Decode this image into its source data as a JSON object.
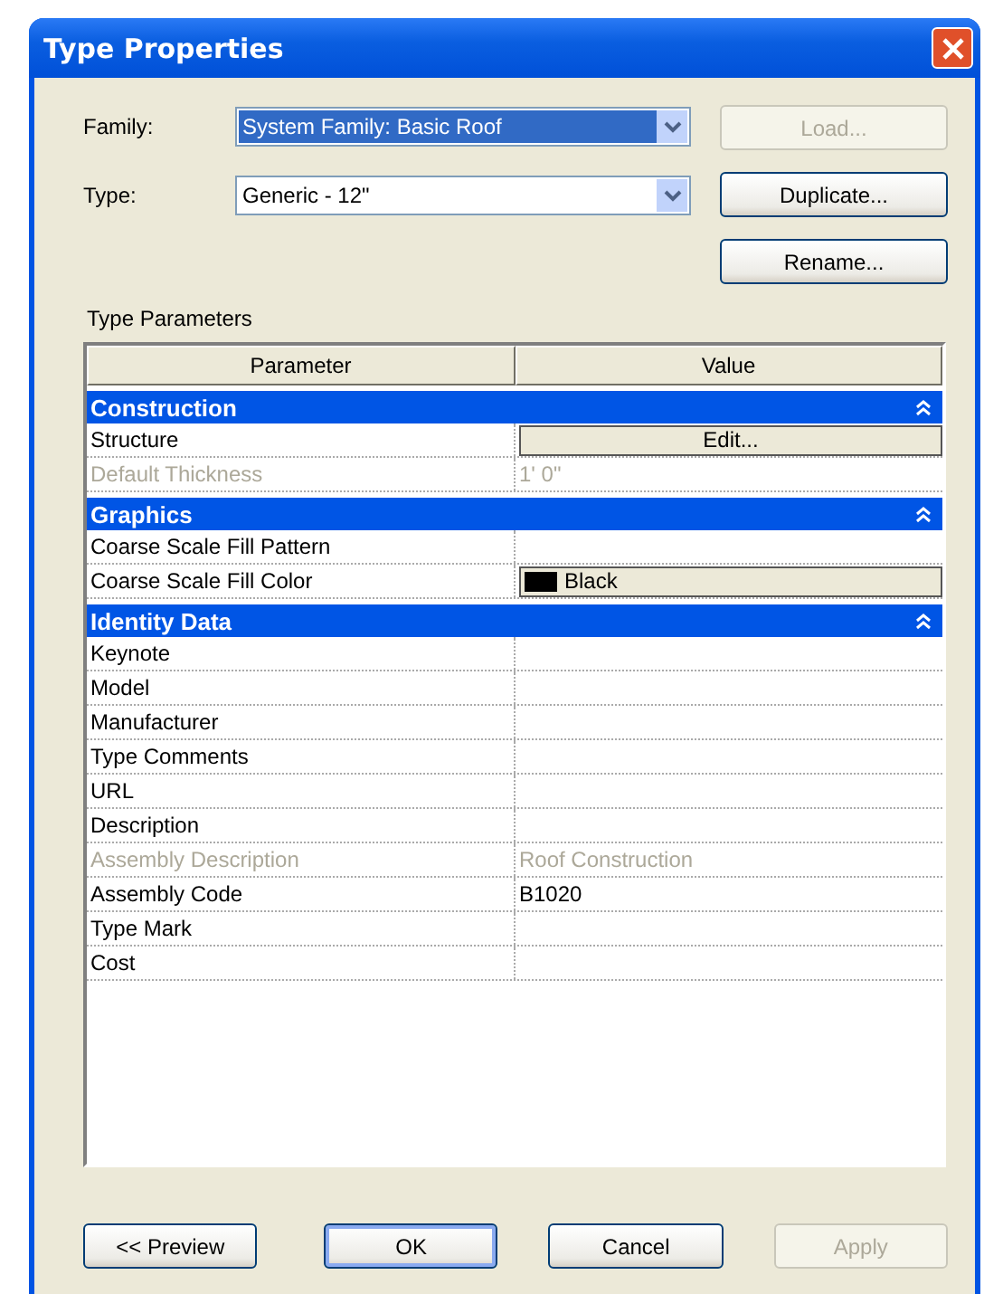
{
  "window": {
    "title": "Type Properties"
  },
  "family": {
    "label": "Family:",
    "value": "System Family: Basic Roof",
    "highlighted": true
  },
  "type": {
    "label": "Type:",
    "value": "Generic - 12\"",
    "highlighted": false
  },
  "side_buttons": [
    {
      "label": "Load...",
      "disabled": true,
      "default": false
    },
    {
      "label": "Duplicate...",
      "disabled": false,
      "default": false
    },
    {
      "label": "Rename...",
      "disabled": false,
      "default": false
    }
  ],
  "section_label": "Type Parameters",
  "table": {
    "columns": [
      "Parameter",
      "Value"
    ],
    "groups": [
      {
        "name": "Construction",
        "expanded": true,
        "rows": [
          {
            "name": "Structure",
            "kind": "button",
            "value": "Edit...",
            "disabled": false
          },
          {
            "name": "Default Thickness",
            "kind": "text",
            "value": "1'  0\"",
            "disabled": true
          }
        ]
      },
      {
        "name": "Graphics",
        "expanded": true,
        "rows": [
          {
            "name": "Coarse Scale Fill Pattern",
            "kind": "text",
            "value": "",
            "disabled": false
          },
          {
            "name": "Coarse Scale Fill Color",
            "kind": "color",
            "value": "Black",
            "color": "#000000",
            "disabled": false
          }
        ]
      },
      {
        "name": "Identity Data",
        "expanded": true,
        "rows": [
          {
            "name": "Keynote",
            "kind": "text",
            "value": "",
            "disabled": false
          },
          {
            "name": "Model",
            "kind": "text",
            "value": "",
            "disabled": false
          },
          {
            "name": "Manufacturer",
            "kind": "text",
            "value": "",
            "disabled": false
          },
          {
            "name": "Type Comments",
            "kind": "text",
            "value": "",
            "disabled": false
          },
          {
            "name": "URL",
            "kind": "text",
            "value": "",
            "disabled": false
          },
          {
            "name": "Description",
            "kind": "text",
            "value": "",
            "disabled": false
          },
          {
            "name": "Assembly Description",
            "kind": "text",
            "value": "Roof Construction",
            "disabled": true
          },
          {
            "name": "Assembly Code",
            "kind": "text",
            "value": "B1020",
            "disabled": false
          },
          {
            "name": "Type Mark",
            "kind": "text",
            "value": "",
            "disabled": false
          },
          {
            "name": "Cost",
            "kind": "text",
            "value": "",
            "disabled": false
          }
        ]
      }
    ]
  },
  "bottom_buttons": [
    {
      "label": "<< Preview",
      "disabled": false,
      "default": false
    },
    {
      "label": "OK",
      "disabled": false,
      "default": true
    },
    {
      "label": "Cancel",
      "disabled": false,
      "default": false
    },
    {
      "label": "Apply",
      "disabled": true,
      "default": false
    }
  ]
}
